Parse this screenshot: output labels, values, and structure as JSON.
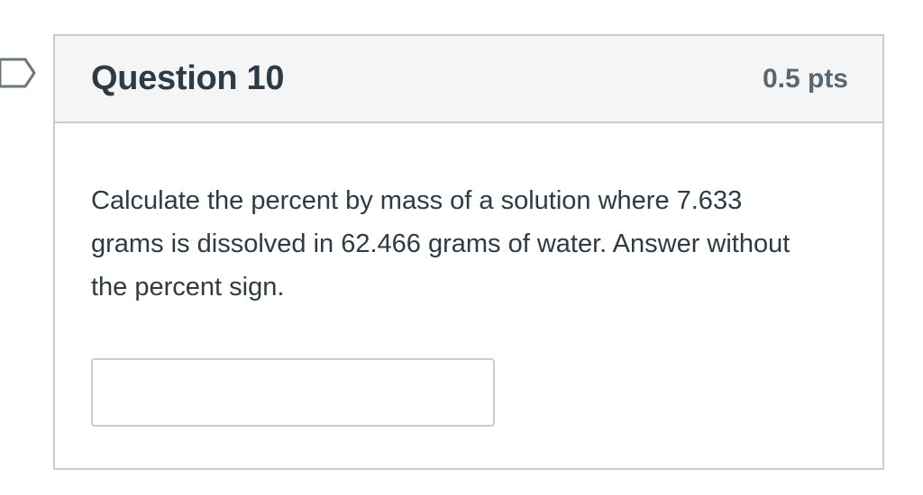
{
  "question": {
    "title": "Question 10",
    "points": "0.5 pts",
    "text": "Calculate the percent by mass of a solution where 7.633 grams is dissolved in 62.466 grams of water.  Answer without the percent sign.",
    "answer_value": "",
    "answer_placeholder": ""
  },
  "icons": {
    "flag": "flag-icon"
  },
  "colors": {
    "border": "#c7cdd1",
    "header_background": "#f5f5f5",
    "text": "#2d3b45",
    "points_text": "#5b6770"
  }
}
